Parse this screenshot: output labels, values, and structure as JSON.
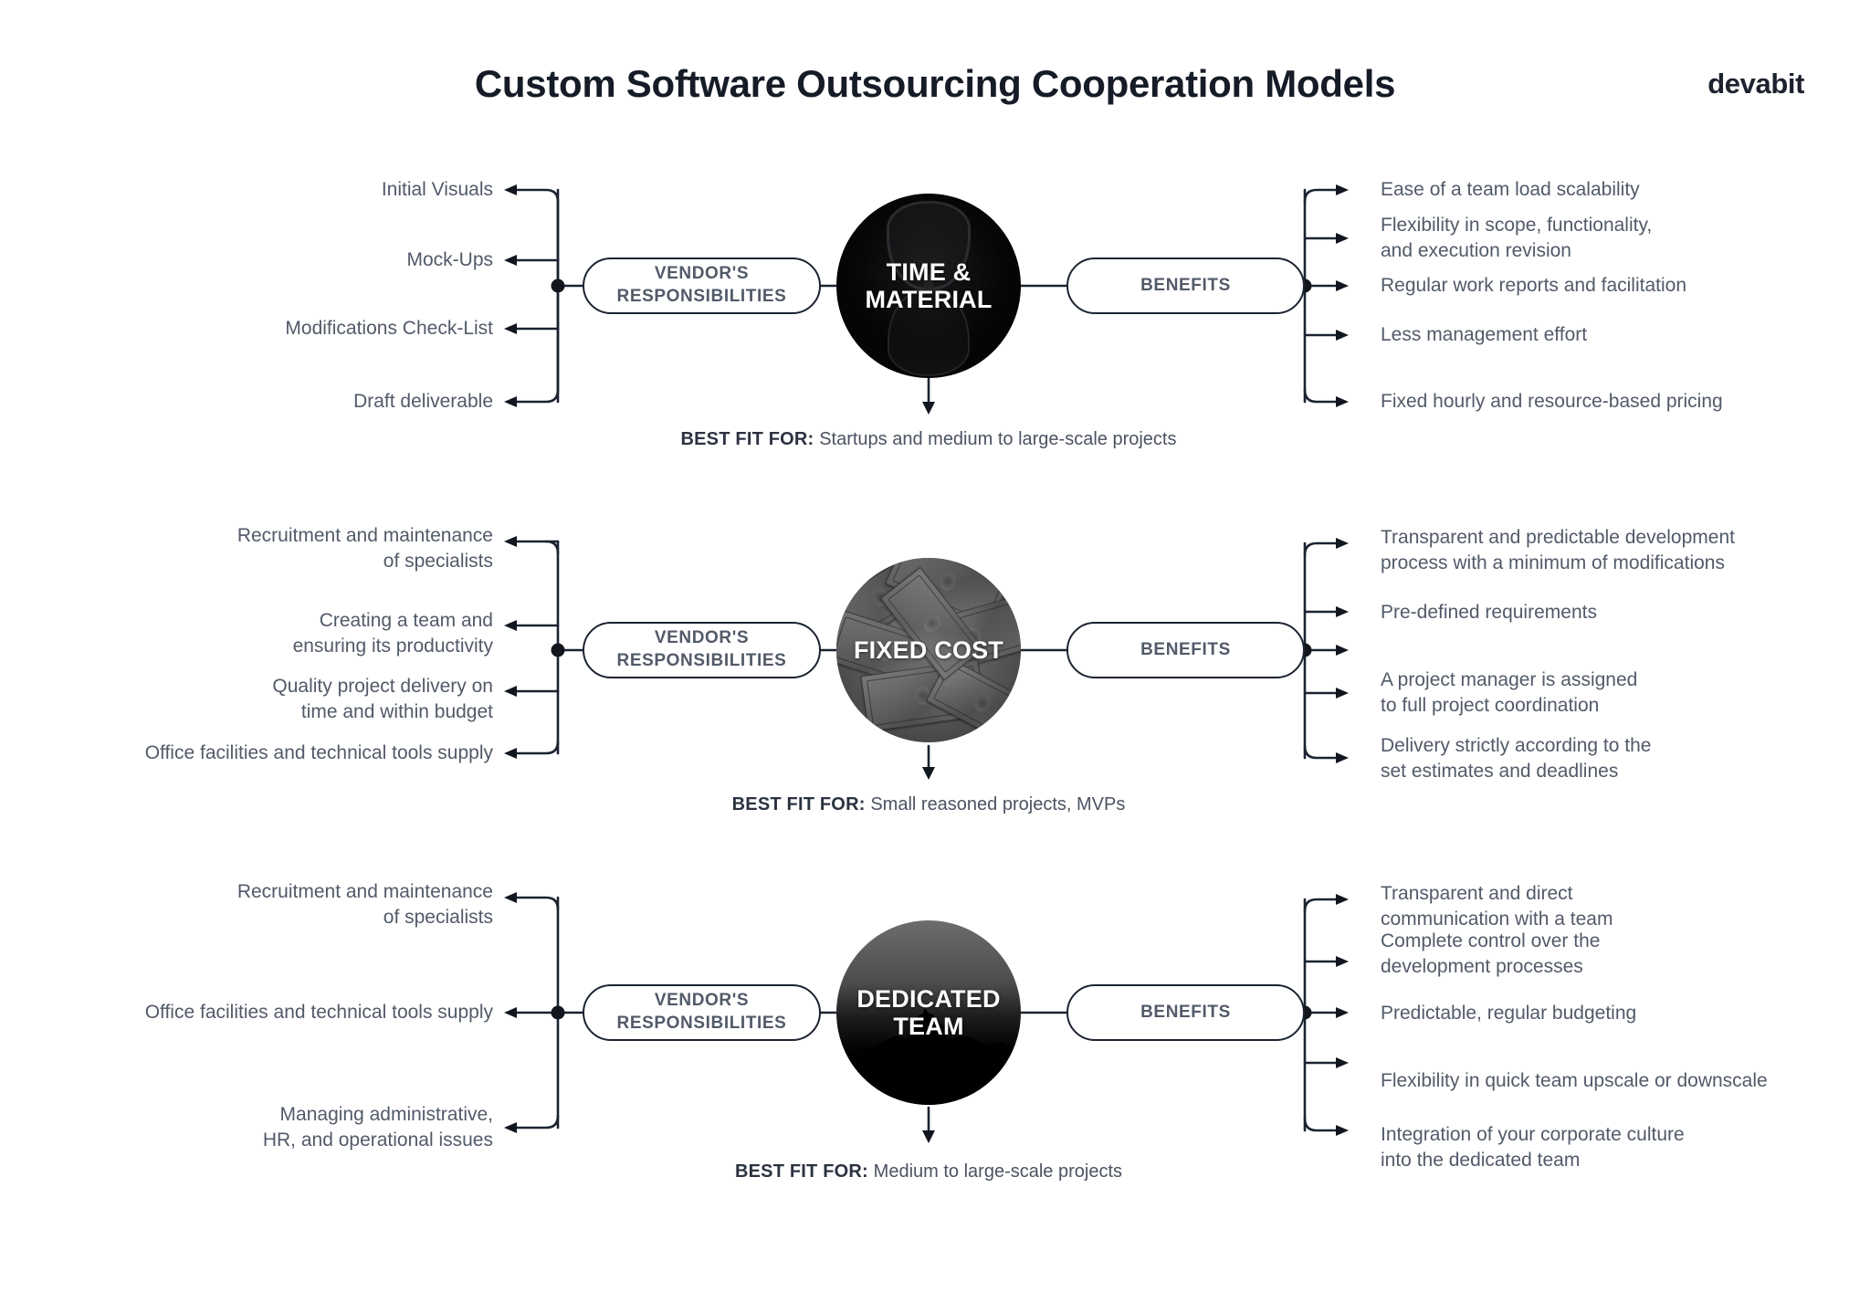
{
  "header": {
    "title": "Custom Software Outsourcing Cooperation Models",
    "logo": "devabit"
  },
  "common": {
    "vendor_label": "VENDOR'S\nRESPONSIBILITIES",
    "benefits_label": "BENEFITS",
    "best_fit_label": "BEST FIT FOR:"
  },
  "sections": [
    {
      "id": "time-and-material",
      "hub_title": "TIME &\nMATERIAL",
      "hub_art": "hourglass-photo",
      "best_fit_value": "Startups and medium to large-scale projects",
      "responsibilities": [
        "Initial Visuals",
        "Mock-Ups",
        "Modifications Check-List",
        "Draft deliverable"
      ],
      "benefits": [
        "Ease of a team load scalability",
        "Flexibility in scope, functionality,\nand execution revision",
        "Regular work reports and facilitation",
        "Less management effort",
        "Fixed hourly and resource-based pricing"
      ]
    },
    {
      "id": "fixed-cost",
      "hub_title": "FIXED\nCOST",
      "hub_art": "dollar-bills-photo",
      "best_fit_value": "Small reasoned projects, MVPs",
      "responsibilities": [
        "Recruitment and maintenance\nof specialists",
        "Creating a team and\nensuring its productivity",
        "Quality project delivery on\ntime and within budget",
        "Office facilities and technical tools supply"
      ],
      "benefits": [
        "Transparent and predictable development\nprocess with a minimum of modifications",
        "Pre-defined requirements",
        "A project manager is assigned\nto full project coordination",
        "Delivery strictly according to the\nset estimates and deadlines"
      ]
    },
    {
      "id": "dedicated-team",
      "hub_title": "DEDICATED\nTEAM",
      "hub_art": "landscape-silhouette-photo",
      "best_fit_value": "Medium to large-scale projects",
      "responsibilities": [
        "Recruitment and maintenance\nof specialists",
        "Office facilities and technical tools supply",
        "Managing administrative,\nHR, and operational issues"
      ],
      "benefits": [
        "Transparent and direct\ncommunication with a team",
        "Complete control over the\ndevelopment processes",
        "Predictable, regular budgeting",
        "Flexibility in quick team upscale or downscale",
        "Integration of your corporate culture\ninto the dedicated team"
      ]
    }
  ],
  "colors": {
    "text": "#525a69",
    "title": "#161c27",
    "stroke": "#1b2331",
    "background": "#ffffff"
  }
}
